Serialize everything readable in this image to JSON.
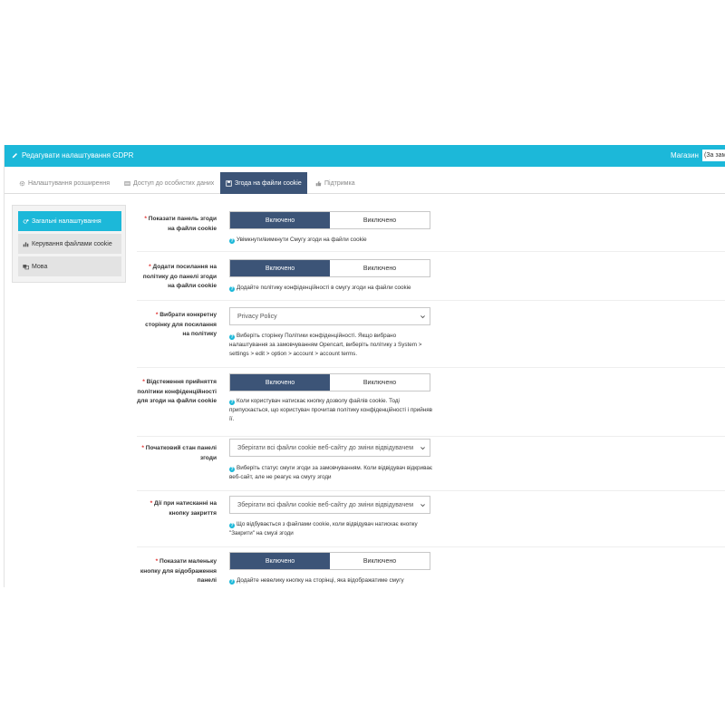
{
  "header": {
    "title": "Редагувати налаштування GDPR",
    "store_label": "Магазин",
    "store_value": "(За замовчуванням)"
  },
  "tabs": [
    {
      "label": "Налаштування розширення",
      "icon": "gear-icon"
    },
    {
      "label": "Доступ до особистих даних",
      "icon": "table-icon"
    },
    {
      "label": "Згода на файли cookie",
      "icon": "save-icon"
    },
    {
      "label": "Підтримка",
      "icon": "thumbs-up-icon"
    }
  ],
  "sidebar": {
    "items": [
      {
        "label": "Загальні налаштування",
        "icon": "cogs-icon"
      },
      {
        "label": "Керування файлами cookie",
        "icon": "bar-chart-icon"
      },
      {
        "label": "Мова",
        "icon": "language-icon"
      }
    ]
  },
  "toggle": {
    "on": "Включено",
    "off": "Виключено"
  },
  "fields": [
    {
      "label": "Показати панель згоди на файли cookie",
      "type": "toggle",
      "value": "on",
      "help": "Увімкнути/вимкнути Смугу згоди на файли cookie"
    },
    {
      "label": "Додати посилання на політику до панелі згоди на файли cookie",
      "type": "toggle",
      "value": "on",
      "help": "Додайте політику конфіденційності в смугу згоди на файли cookie"
    },
    {
      "label": "Вибрати конкретну сторінку для посилання на політику",
      "type": "select",
      "value": "Privacy Policy",
      "help": "Виберіть сторінку Політики конфіденційності. Якщо вибрано налаштування за замовчуванням Opencart, виберіть політику з System > settings > edit > option > account > account terms."
    },
    {
      "label": "Відстеження прийняття політики конфіденційності для згоди на файли cookie",
      "type": "toggle",
      "value": "on",
      "help": "Коли користувач натискає кнопку дозволу файлів cookie. Тоді припускається, що користувач прочитав політику конфіденційності і прийняв її."
    },
    {
      "label": "Початковий стан панелі згоди",
      "type": "select",
      "value": "Зберігати всі файли cookie веб-сайту до зміни відвідувачем",
      "help": "Виберіть статус смуги згоди за замовчуванням. Коли відвідувач відкриває веб-сайт, але не реагує на смугу згоди"
    },
    {
      "label": "Дії при натисканні на кнопку закриття",
      "type": "select",
      "value": "Зберігати всі файли cookie веб-сайту до зміни відвідувачем",
      "help": "Що відбувається з файлами cookie, коли відвідувач натискає кнопку \"Закрити\" на смузі згоди"
    },
    {
      "label": "Показати маленьку кнопку для відображення панелі",
      "type": "toggle",
      "value": "on",
      "help": "Додайте невелику кнопку на сторінці, яка відображатиме смугу"
    }
  ],
  "colors": {
    "accent": "#1cb8d9",
    "active_tab": "#3c5477",
    "required": "#e0302f"
  }
}
